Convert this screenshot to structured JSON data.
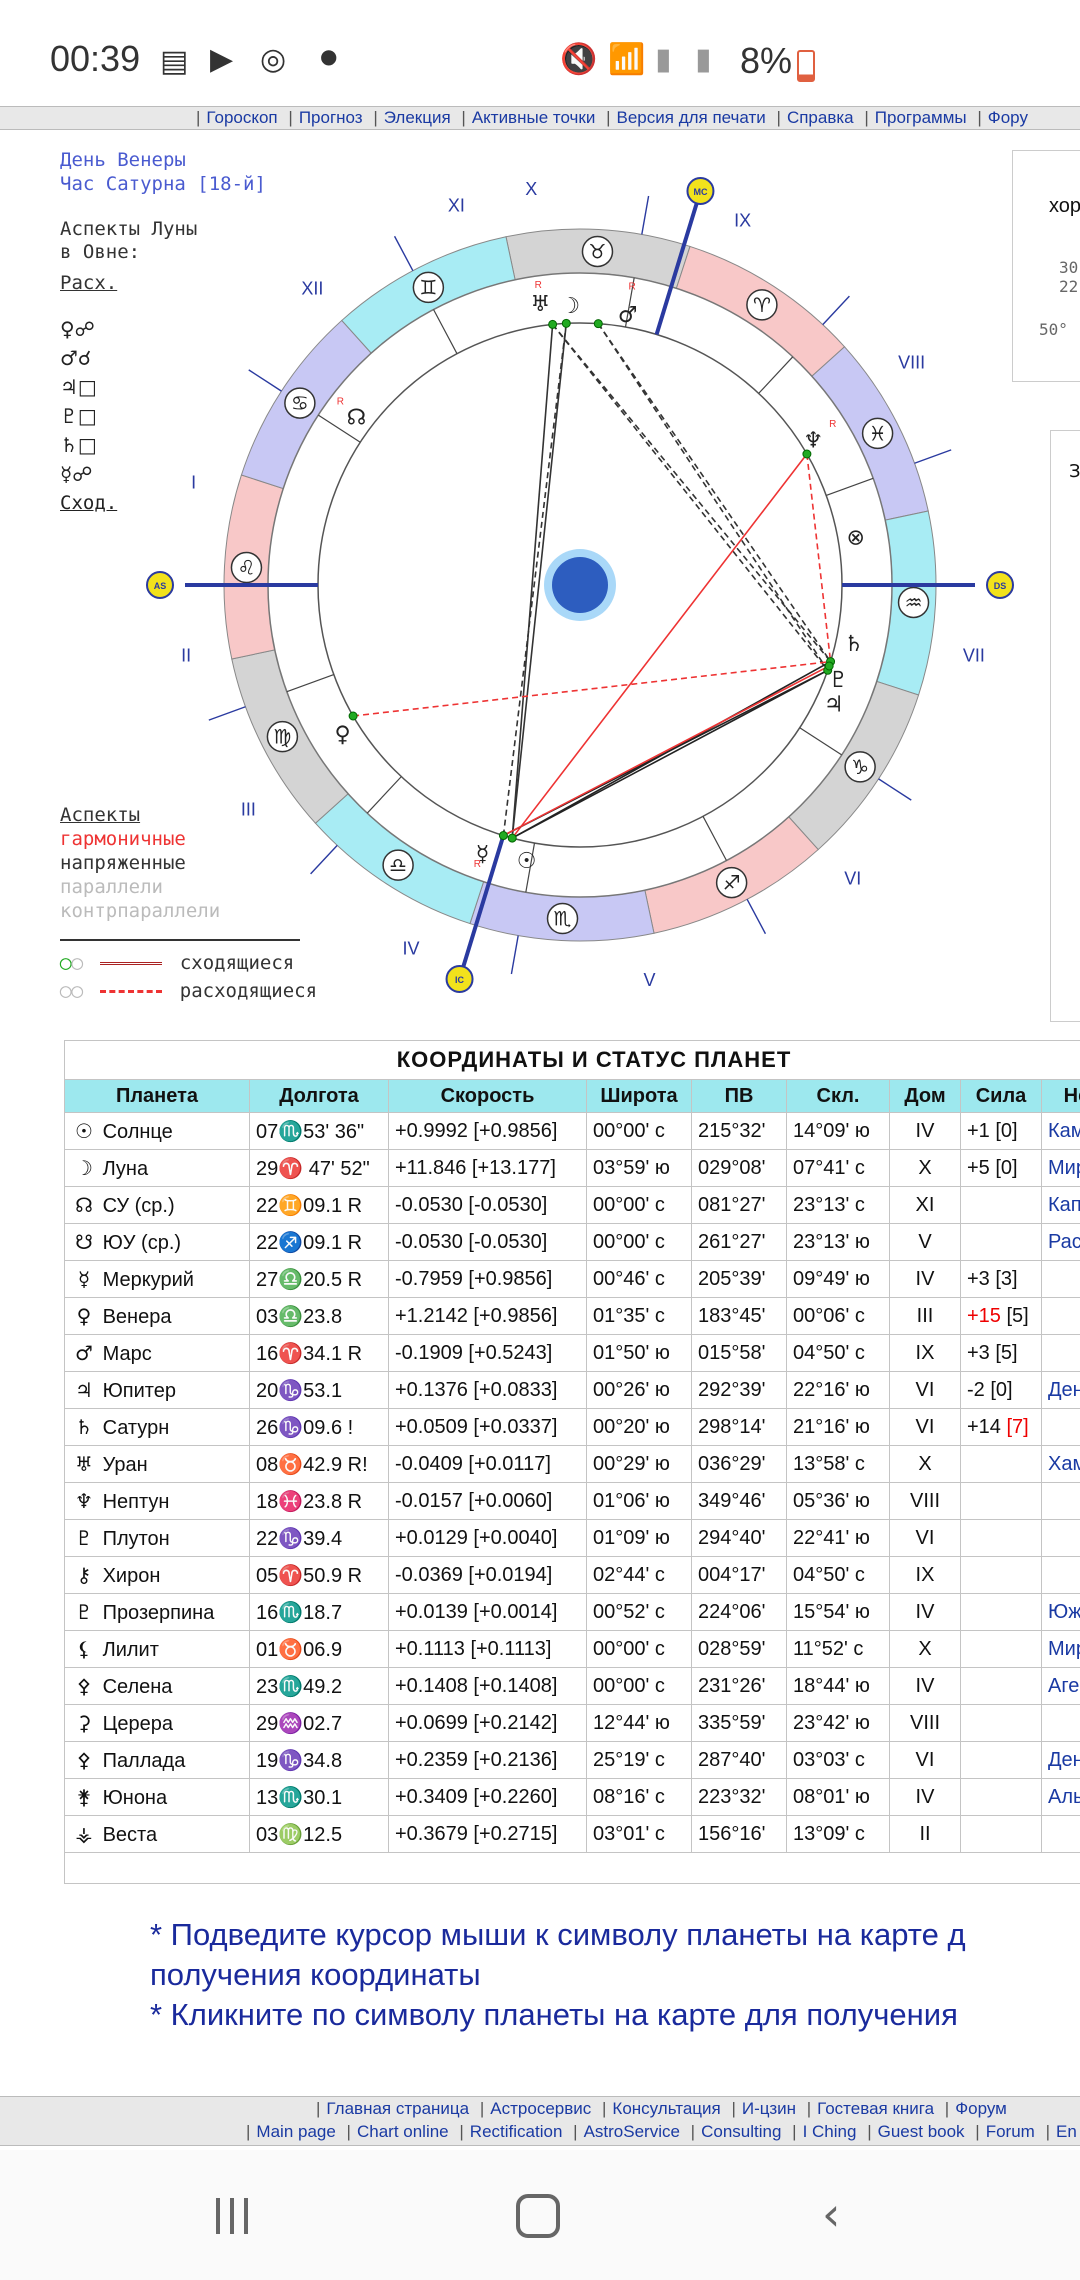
{
  "status_bar": {
    "time": "00:39",
    "battery": "8%"
  },
  "top_menu": [
    "Гороскоп",
    "Прогноз",
    "Элекция",
    "Активные точки",
    "Версия для печати",
    "Справка",
    "Программы",
    "Фору"
  ],
  "left_info": {
    "line1": "День Венеры",
    "line2": "Час Сатурна [18-й]",
    "moon_aspects_1": "Аспекты Луны",
    "moon_aspects_2": "в Овне:",
    "rasx": "Расх.",
    "shod": "Сход."
  },
  "rasx_list": [
    "♀☍",
    "♂☌",
    "♃□",
    "♇□",
    "♄□",
    "☿☍"
  ],
  "aspects_legend": {
    "title": "Аспекты",
    "harmonic": "гармоничные",
    "tense": "напряженные",
    "parallels": "параллели",
    "contraparallels": "контрпараллели",
    "converging": "сходящиеся",
    "diverging": "расходящиеся"
  },
  "chart": {
    "house_numerals": [
      "X",
      "IX",
      "VIII",
      "VII",
      "VI",
      "V",
      "IV",
      "III",
      "II",
      "I",
      "XII",
      "XI"
    ],
    "axis_labels": {
      "mc": "MC",
      "ds": "DS",
      "ic": "IC",
      "as": "AS"
    },
    "zodiac_glyphs": [
      "♉",
      "♈",
      "♓",
      "♒",
      "♑",
      "♐",
      "♏",
      "♎",
      "♍",
      "♌",
      "♋",
      "♊"
    ],
    "planet_glyphs": {
      "uranus": "♅",
      "moon": "☽",
      "mars": "♂",
      "node": "☊",
      "neptune": "♆",
      "saturn": "♄",
      "pluto": "♇",
      "jupiter": "♃",
      "venus": "♀",
      "mercury": "☿",
      "sun": "☉",
      "part": "⊗"
    },
    "retro": "R"
  },
  "table": {
    "caption": "КООРДИНАТЫ И СТАТУС ПЛАНЕТ",
    "headers": [
      "Планета",
      "Долгота",
      "Скорость",
      "Широта",
      "ПВ",
      "Скл.",
      "Дом",
      "Сила",
      "Неп"
    ],
    "rows": [
      {
        "g": "☉",
        "name": "Солнце",
        "lon": "07♏53' 36\"",
        "speed": "+0.9992 [+0.9856]",
        "lat": "00°00' с",
        "pv": "215°32'",
        "decl": "14°09' ю",
        "house": "IV",
        "power": "+1",
        "pwr2": "[0]",
        "pwr2_red": false,
        "pwr_red": false,
        "star": "Камба"
      },
      {
        "g": "☽",
        "name": "Луна",
        "lon": "29♈ 47' 52\"",
        "speed": "+11.846 [+13.177]",
        "lat": "03°59' ю",
        "pv": "029°08'",
        "decl": "07°41' с",
        "house": "X",
        "power": "+5",
        "pwr2": "[0]",
        "pwr2_red": false,
        "pwr_red": false,
        "star": "Мирах"
      },
      {
        "g": "☊",
        "name": "СУ (ср.)",
        "lon": "22♊09.1  R",
        "speed": "-0.0530 [-0.0530]",
        "lat": "00°00' с",
        "pv": "081°27'",
        "decl": "23°13' с",
        "house": "XI",
        "power": "",
        "pwr2": "",
        "pwr2_red": false,
        "pwr_red": false,
        "star": "Капел"
      },
      {
        "g": "☋",
        "name": "ЮУ (ср.)",
        "lon": "22♐09.1  R",
        "speed": "-0.0530 [-0.0530]",
        "lat": "00°00' с",
        "pv": "261°27'",
        "decl": "23°13' ю",
        "house": "V",
        "power": "",
        "pwr2": "",
        "pwr2_red": false,
        "pwr_red": false,
        "star": "Расал"
      },
      {
        "g": "☿",
        "name": "Меркурий",
        "lon": "27♎20.5  R",
        "speed": "-0.7959 [+0.9856]",
        "lat": "00°46' с",
        "pv": "205°39'",
        "decl": "09°49' ю",
        "house": "IV",
        "power": "+3",
        "pwr2": "[3]",
        "pwr2_red": false,
        "pwr_red": false,
        "star": ""
      },
      {
        "g": "♀",
        "name": "Венера",
        "lon": "03♎23.8",
        "speed": "+1.2142 [+0.9856]",
        "lat": "01°35' с",
        "pv": "183°45'",
        "decl": "00°06' с",
        "house": "III",
        "power": "+15",
        "pwr2": "[5]",
        "pwr2_red": false,
        "pwr_red": true,
        "star": ""
      },
      {
        "g": "♂",
        "name": "Марс",
        "lon": "16♈34.1  R",
        "speed": "-0.1909 [+0.5243]",
        "lat": "01°50' ю",
        "pv": "015°58'",
        "decl": "04°50' с",
        "house": "IX",
        "power": "+3",
        "pwr2": "[5]",
        "pwr2_red": false,
        "pwr_red": false,
        "star": ""
      },
      {
        "g": "♃",
        "name": "Юпитер",
        "lon": "20♑53.1",
        "speed": "+0.1376 [+0.0833]",
        "lat": "00°26' ю",
        "pv": "292°39'",
        "decl": "22°16' ю",
        "house": "VI",
        "power": "-2",
        "pwr2": "[0]",
        "pwr2_red": false,
        "pwr_red": false,
        "star": "Денеб"
      },
      {
        "g": "♄",
        "name": "Сатурн",
        "lon": "26♑09.6 !",
        "speed": "+0.0509 [+0.0337]",
        "lat": "00°20' ю",
        "pv": "298°14'",
        "decl": "21°16' ю",
        "house": "VI",
        "power": "+14",
        "pwr2": "[7]",
        "pwr2_red": true,
        "pwr_red": false,
        "star": ""
      },
      {
        "g": "♅",
        "name": "Уран",
        "lon": "08♉42.9  R!",
        "speed": "-0.0409 [+0.0117]",
        "lat": "00°29' ю",
        "pv": "036°29'",
        "decl": "13°58' с",
        "house": "X",
        "power": "",
        "pwr2": "",
        "pwr2_red": false,
        "pwr_red": false,
        "star": "Хамал"
      },
      {
        "g": "♆",
        "name": "Нептун",
        "lon": "18♓23.8  R",
        "speed": "-0.0157 [+0.0060]",
        "lat": "01°06' ю",
        "pv": "349°46'",
        "decl": "05°36' ю",
        "house": "VIII",
        "power": "",
        "pwr2": "",
        "pwr2_red": false,
        "pwr_red": false,
        "star": ""
      },
      {
        "g": "♇",
        "name": "Плутон",
        "lon": "22♑39.4",
        "speed": "+0.0129 [+0.0040]",
        "lat": "01°09' ю",
        "pv": "294°40'",
        "decl": "22°41' ю",
        "house": "VI",
        "power": "",
        "pwr2": "",
        "pwr2_red": false,
        "pwr_red": false,
        "star": ""
      },
      {
        "g": "⚷",
        "name": "Хирон",
        "lon": "05♈50.9  R",
        "speed": "-0.0369 [+0.0194]",
        "lat": "02°44' с",
        "pv": "004°17'",
        "decl": "04°50' с",
        "house": "IX",
        "power": "",
        "pwr2": "",
        "pwr2_red": false,
        "pwr_red": false,
        "star": ""
      },
      {
        "g": "♇",
        "name": "Прозерпина",
        "lon": "16♏18.7",
        "speed": "+0.0139 [+0.0014]",
        "lat": "00°52' с",
        "pv": "224°06'",
        "decl": "15°54' ю",
        "house": "IV",
        "power": "",
        "pwr2": "",
        "pwr2_red": false,
        "pwr_red": false,
        "star": "Южна"
      },
      {
        "g": "⚸",
        "name": "Лилит",
        "lon": "01♉06.9",
        "speed": "+0.1113 [+0.1113]",
        "lat": "00°00' с",
        "pv": "028°59'",
        "decl": "11°52' с",
        "house": "X",
        "power": "",
        "pwr2": "",
        "pwr2_red": false,
        "pwr_red": false,
        "star": "Мирах"
      },
      {
        "g": "⚴",
        "name": "Селена",
        "lon": "23♏49.2",
        "speed": "+0.1408 [+0.1408]",
        "lat": "00°00' с",
        "pv": "231°26'",
        "decl": "18°44' ю",
        "house": "IV",
        "power": "",
        "pwr2": "",
        "pwr2_red": false,
        "pwr_red": false,
        "star": "Агена"
      },
      {
        "g": "⚳",
        "name": "Церера",
        "lon": "29♒02.7",
        "speed": "+0.0699 [+0.2142]",
        "lat": "12°44' ю",
        "pv": "335°59'",
        "decl": "23°42' ю",
        "house": "VIII",
        "power": "",
        "pwr2": "",
        "pwr2_red": false,
        "pwr_red": false,
        "star": ""
      },
      {
        "g": "⚴",
        "name": "Паллада",
        "lon": "19♑34.8",
        "speed": "+0.2359 [+0.2136]",
        "lat": "25°19' с",
        "pv": "287°40'",
        "decl": "03°03' с",
        "house": "VI",
        "power": "",
        "pwr2": "",
        "pwr2_red": false,
        "pwr_red": false,
        "star": "Денеб"
      },
      {
        "g": "⚵",
        "name": "Юнона",
        "lon": "13♏30.1",
        "speed": "+0.3409 [+0.2260]",
        "lat": "08°16' с",
        "pv": "223°32'",
        "decl": "08°01' ю",
        "house": "IV",
        "power": "",
        "pwr2": "",
        "pwr2_red": false,
        "pwr_red": false,
        "star": "Альфе"
      },
      {
        "g": "⚶",
        "name": "Веста",
        "lon": "03♍12.5",
        "speed": "+0.3679 [+0.2715]",
        "lat": "03°01' с",
        "pv": "156°16'",
        "decl": "13°09' с",
        "house": "II",
        "power": "",
        "pwr2": "",
        "pwr2_red": false,
        "pwr_red": false,
        "star": ""
      }
    ]
  },
  "notes": {
    "note1_line1": " * Подведите курсор мыши к символу планеты на карте д",
    "note1_line2": "получения координаты",
    "note2_line1": " * Кликните по символу планеты на карте для получения"
  },
  "bottom_menu_row1": [
    "Главная страница",
    "Астросервис",
    "Консультация",
    "И-цзин",
    "Гостевая книга",
    "Форум"
  ],
  "bottom_menu_row2": [
    "Main page",
    "Chart online",
    "Rectification",
    "AstroService",
    "Consulting",
    "I Ching",
    "Guest book",
    "Forum",
    "En"
  ]
}
